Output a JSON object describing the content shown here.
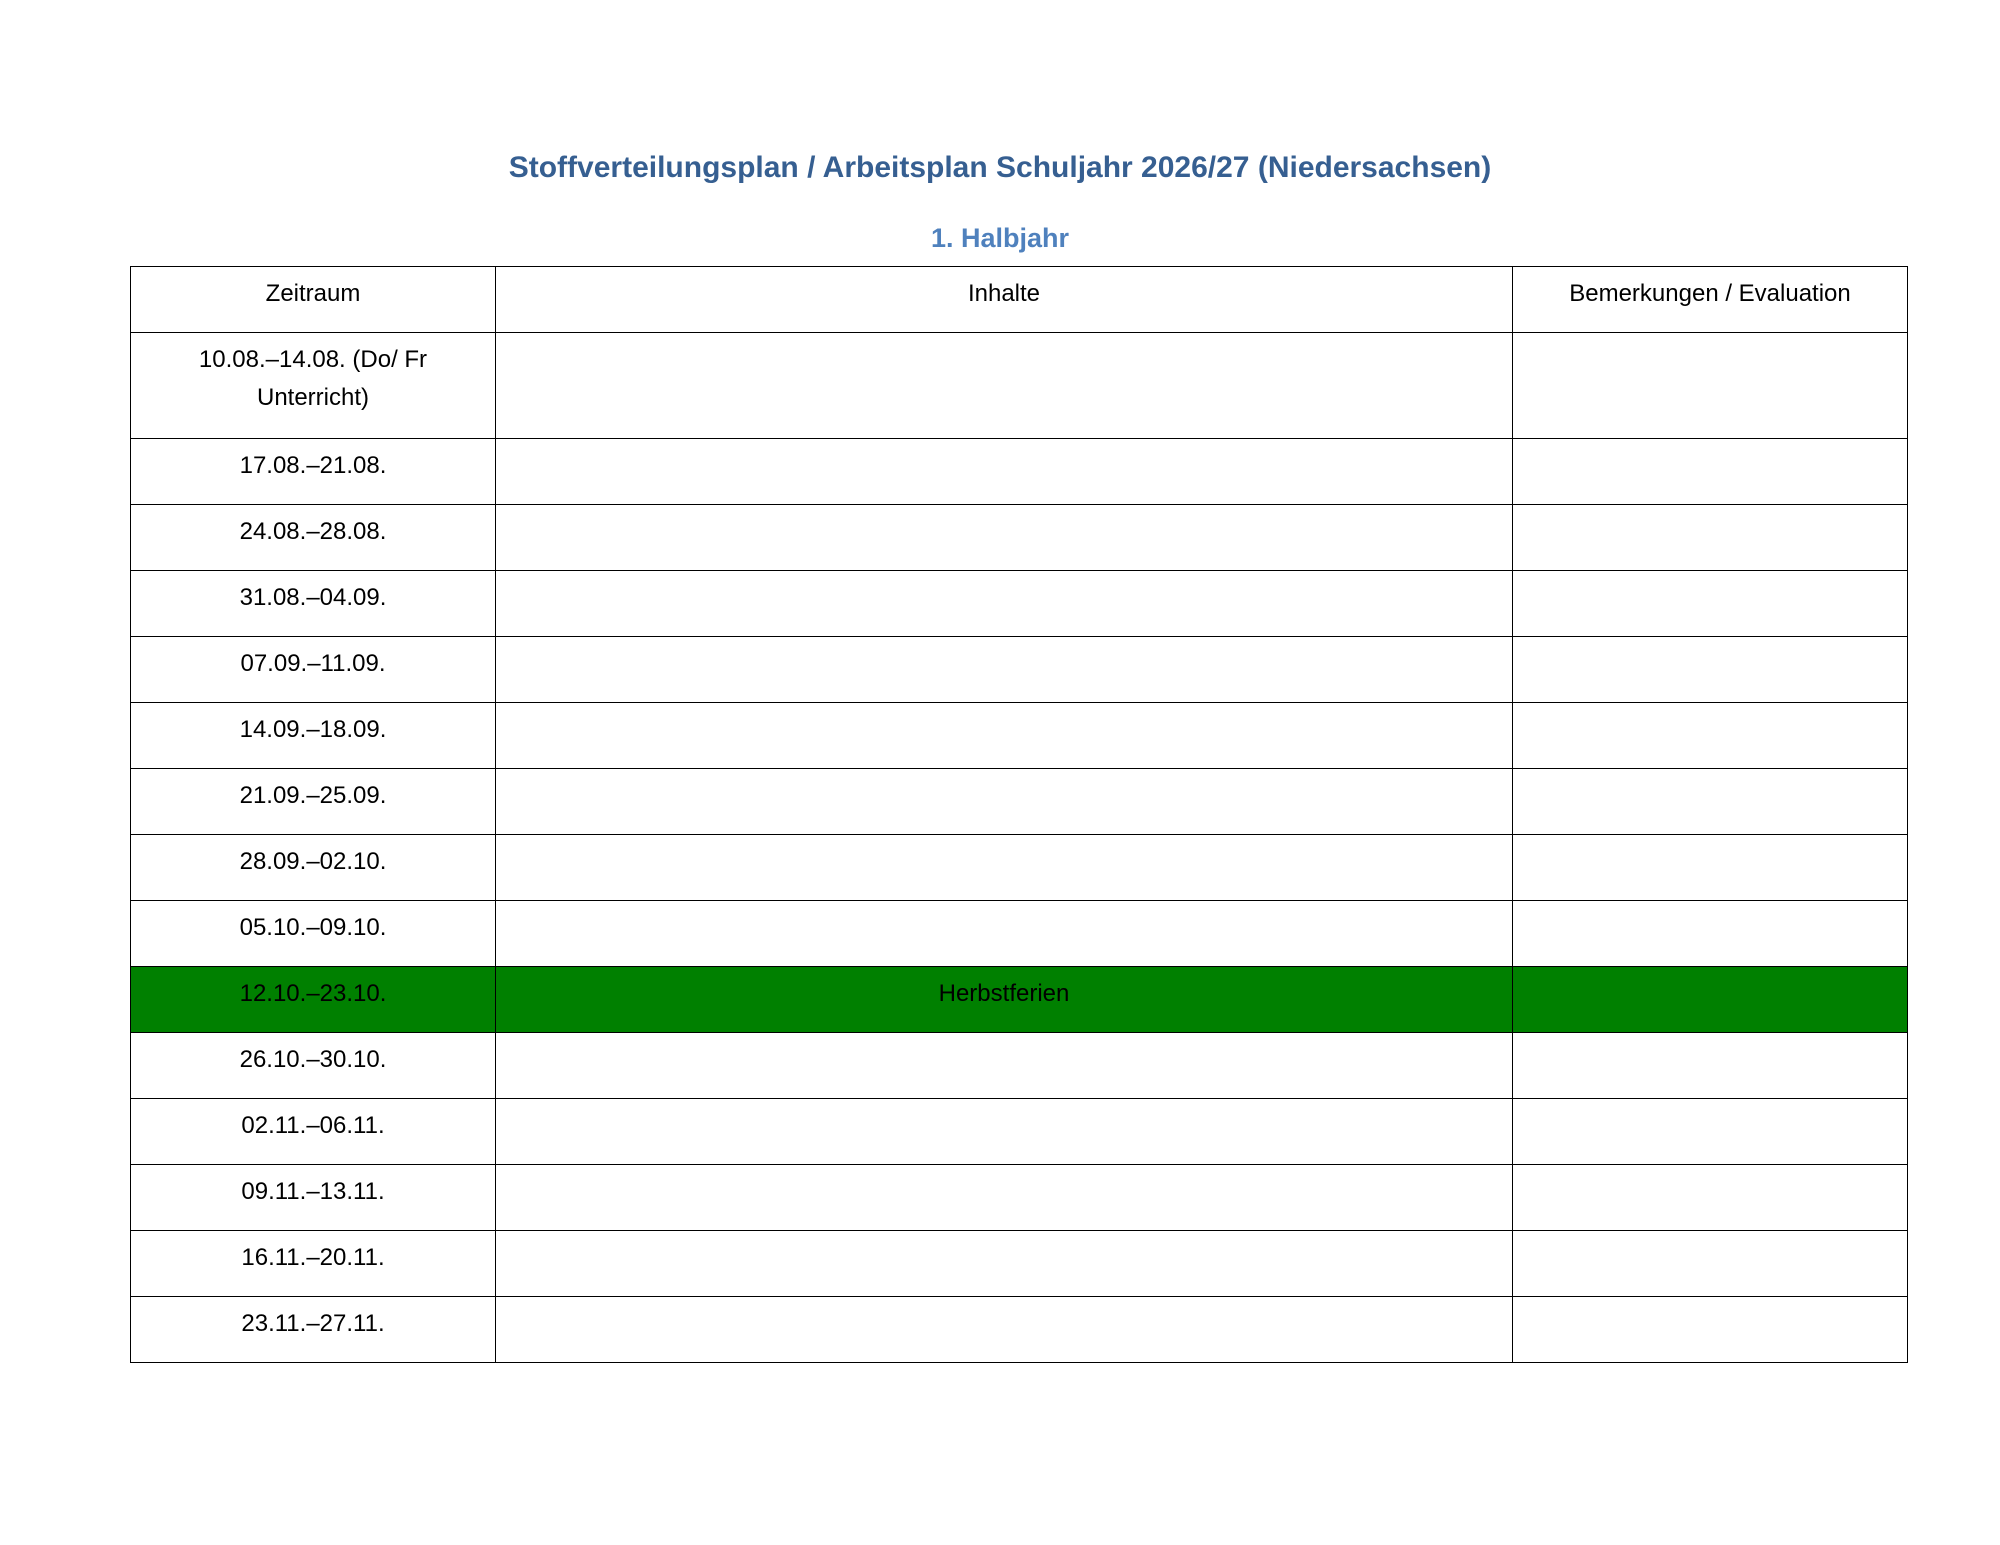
{
  "header": {
    "title": "Stoffverteilungsplan / Arbeitsplan Schuljahr 2026/27 (Niedersachsen)",
    "section": "1. Halbjahr"
  },
  "table": {
    "columns": [
      "Zeitraum",
      "Inhalte",
      "Bemerkungen / Evaluation"
    ],
    "rows": [
      {
        "zeitraum": "10.08.–14.08. (Do/ Fr Unterricht)",
        "inhalte": "",
        "bemerkungen": ""
      },
      {
        "zeitraum": "17.08.–21.08.",
        "inhalte": "",
        "bemerkungen": ""
      },
      {
        "zeitraum": "24.08.–28.08.",
        "inhalte": "",
        "bemerkungen": ""
      },
      {
        "zeitraum": "31.08.–04.09.",
        "inhalte": "",
        "bemerkungen": ""
      },
      {
        "zeitraum": "07.09.–11.09.",
        "inhalte": "",
        "bemerkungen": ""
      },
      {
        "zeitraum": "14.09.–18.09.",
        "inhalte": "",
        "bemerkungen": ""
      },
      {
        "zeitraum": "21.09.–25.09.",
        "inhalte": "",
        "bemerkungen": ""
      },
      {
        "zeitraum": "28.09.–02.10.",
        "inhalte": "",
        "bemerkungen": ""
      },
      {
        "zeitraum": "05.10.–09.10.",
        "inhalte": "",
        "bemerkungen": ""
      },
      {
        "zeitraum": "12.10.–23.10.",
        "inhalte": "Herbstferien",
        "bemerkungen": ""
      },
      {
        "zeitraum": "26.10.–30.10.",
        "inhalte": "",
        "bemerkungen": ""
      },
      {
        "zeitraum": "02.11.–06.11.",
        "inhalte": "",
        "bemerkungen": ""
      },
      {
        "zeitraum": "09.11.–13.11.",
        "inhalte": "",
        "bemerkungen": ""
      },
      {
        "zeitraum": "16.11.–20.11.",
        "inhalte": "",
        "bemerkungen": ""
      },
      {
        "zeitraum": "23.11.–27.11.",
        "inhalte": "",
        "bemerkungen": ""
      }
    ]
  },
  "colors": {
    "title": "#365f91",
    "section": "#4f81bd",
    "holiday_fill": "#008000"
  }
}
